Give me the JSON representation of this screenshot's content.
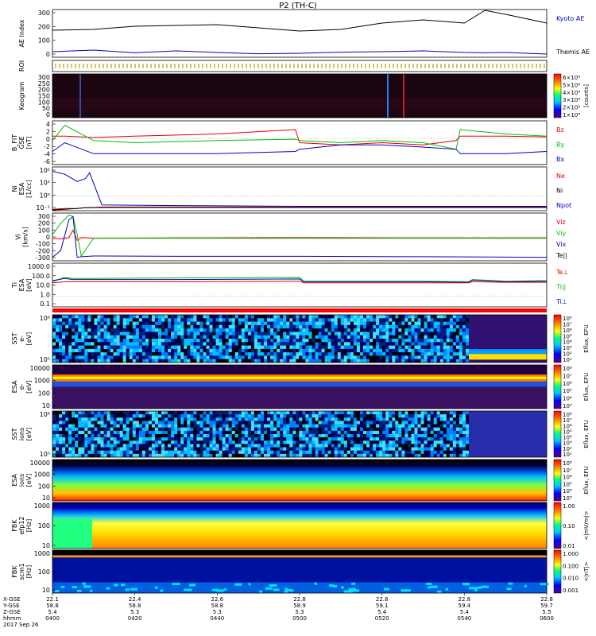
{
  "title": "P2 (TH-C)",
  "date_label": "2017 Sep 26",
  "colors": {
    "black": "#000000",
    "red": "#e00000",
    "green": "#00c000",
    "blue": "#0000c0",
    "navy": "#000080"
  },
  "x_axis": {
    "row_labels": [
      "X-GSE",
      "Y-GSE",
      "Z-GSE",
      "hhmm"
    ],
    "ticks": [
      {
        "time": "0400",
        "x_gse": "22.1",
        "y_gse": "58.8",
        "z_gse": "5.4"
      },
      {
        "time": "0420",
        "x_gse": "22.4",
        "y_gse": "58.8",
        "z_gse": "5.3"
      },
      {
        "time": "0440",
        "x_gse": "22.6",
        "y_gse": "58.8",
        "z_gse": "5.3"
      },
      {
        "time": "0500",
        "x_gse": "22.8",
        "y_gse": "58.9",
        "z_gse": "5.3"
      },
      {
        "time": "0520",
        "x_gse": "22.8",
        "y_gse": "59.1",
        "z_gse": "5.4"
      },
      {
        "time": "0540",
        "x_gse": "22.8",
        "y_gse": "59.4",
        "z_gse": "5.4"
      },
      {
        "time": "0600",
        "x_gse": "22.8",
        "y_gse": "59.7",
        "z_gse": "5.5"
      }
    ]
  },
  "panels": [
    {
      "key": "ae",
      "ylabel": [
        "AE Index"
      ],
      "ticks": [
        "300",
        "200",
        "100",
        "0"
      ],
      "legend": [
        {
          "text": "Kyoto AE",
          "color": "#0000c0"
        },
        {
          "text": "Themis AE",
          "color": "#000000"
        }
      ]
    },
    {
      "key": "roi",
      "ylabel": [
        "ROI"
      ],
      "ticks": [],
      "legend": []
    },
    {
      "key": "keogram",
      "ylabel": [
        "Keogram"
      ],
      "ticks": [
        "300",
        "250",
        "200",
        "150",
        "100",
        "50",
        "0"
      ],
      "legend": [],
      "colorbar": {
        "labels": [
          "6×10⁴",
          "5×10⁴",
          "4×10⁴",
          "3×10⁴",
          "2×10⁴",
          "1×10⁴"
        ],
        "title": "[counts]"
      }
    },
    {
      "key": "bfit",
      "ylabel": [
        "B_FIT",
        "GSE",
        "[nT]"
      ],
      "ticks": [
        "4",
        "2",
        "0",
        "-2",
        "-4",
        "-6"
      ],
      "legend": [
        {
          "text": "Bz",
          "color": "#e00000"
        },
        {
          "text": "By",
          "color": "#00c000"
        },
        {
          "text": "Bx",
          "color": "#0000c0"
        }
      ]
    },
    {
      "key": "ni",
      "ylabel": [
        "Ni",
        "ESA",
        "[1/cc]"
      ],
      "ticks": [
        "10²",
        "10¹",
        "10⁰",
        "10⁻¹"
      ],
      "legend": [
        {
          "text": "Ne",
          "color": "#e00000"
        },
        {
          "text": "Ni",
          "color": "#000000"
        },
        {
          "text": "Npot",
          "color": "#0000c0"
        }
      ]
    },
    {
      "key": "vi",
      "ylabel": [
        "Vi",
        "[km/s]"
      ],
      "ticks": [
        "300",
        "200",
        "100",
        "0",
        "-100",
        "-200",
        "-300"
      ],
      "legend": [
        {
          "text": "Viz",
          "color": "#e00000"
        },
        {
          "text": "Viy",
          "color": "#00c000"
        },
        {
          "text": "Vix",
          "color": "#0000c0"
        },
        {
          "text": "Te||",
          "color": "#000000"
        }
      ]
    },
    {
      "key": "ti",
      "ylabel": [
        "Ti",
        "ESA",
        "[eV]"
      ],
      "ticks": [
        "1000.0",
        "100.0",
        "10.0",
        "1.0",
        "0.1"
      ],
      "legend": [
        {
          "text": "Te⊥",
          "color": "#e00000"
        },
        {
          "text": "Ti||",
          "color": "#00c000"
        },
        {
          "text": "Ti⊥",
          "color": "#0000c0"
        }
      ]
    },
    {
      "key": "mode",
      "ylabel": [],
      "ticks": [],
      "legend": []
    },
    {
      "key": "sst_e",
      "ylabel": [
        "SST",
        "e-",
        "[eV]"
      ],
      "ticks": [
        "10⁶",
        "10⁵"
      ],
      "legend": [],
      "colorbar": {
        "labels": [
          "10⁸",
          "10⁷",
          "10⁶",
          "10⁵",
          "10⁴",
          "10³",
          "10²",
          "10¹"
        ],
        "title": "Eflux, EFU"
      }
    },
    {
      "key": "esa_e",
      "ylabel": [
        "ESA",
        "e-",
        "[eV]"
      ],
      "ticks": [
        "10000",
        "1000",
        "100",
        "10"
      ],
      "legend": [],
      "colorbar": {
        "labels": [
          "10⁸",
          "10⁷",
          "10⁶",
          "10⁵",
          "10⁴",
          "10³"
        ],
        "title": "Eflux, EFU"
      }
    },
    {
      "key": "sst_i",
      "ylabel": [
        "SST",
        "ions",
        "[eV]"
      ],
      "ticks": [
        "10⁶",
        "10⁵"
      ],
      "legend": [],
      "colorbar": {
        "labels": [
          "10⁸",
          "10⁷",
          "10⁶",
          "10⁵",
          "10⁴",
          "10³",
          "10²",
          "10¹"
        ],
        "title": "Eflux, EFU"
      }
    },
    {
      "key": "esa_i",
      "ylabel": [
        "ESA",
        "ions",
        "[eV]"
      ],
      "ticks": [
        "10000",
        "1000",
        "100",
        "10"
      ],
      "legend": [],
      "colorbar": {
        "labels": [
          "10⁸",
          "10⁷",
          "10⁶",
          "10⁵",
          "10⁴",
          "10³"
        ],
        "title": "Eflux, EFU"
      }
    },
    {
      "key": "fbk_e",
      "ylabel": [
        "FBK",
        "efp12",
        "[Hz]"
      ],
      "ticks": [
        "1000",
        "100",
        "10"
      ],
      "legend": [],
      "colorbar": {
        "labels": [
          "1.00",
          "0.10",
          "0.01"
        ],
        "title": "<|mV/m|>"
      }
    },
    {
      "key": "fbk_b",
      "ylabel": [
        "FBK",
        "scm1",
        "[Hz]"
      ],
      "ticks": [
        "1000",
        "100",
        "10"
      ],
      "legend": [],
      "colorbar": {
        "labels": [
          "1.000",
          "0.100",
          "0.010",
          "0.001"
        ],
        "title": "<|nT|>"
      }
    }
  ],
  "chart_data": {
    "type": "line",
    "title": "P2 (TH-C)",
    "x_tick_labels": [
      "0400",
      "0420",
      "0440",
      "0500",
      "0520",
      "0540",
      "0600"
    ],
    "x_range": [
      "0400",
      "0600"
    ],
    "line_panels": [
      {
        "panel": "AE Index",
        "ylim": [
          0,
          300
        ],
        "x": [
          "0400",
          "0410",
          "0420",
          "0430",
          "0440",
          "0450",
          "0500",
          "0510",
          "0520",
          "0530",
          "0540",
          "0545",
          "0550",
          "0600"
        ],
        "series": [
          {
            "name": "Themis AE",
            "color": "#000000",
            "values": [
              170,
              175,
              195,
              200,
              205,
              185,
              165,
              175,
              215,
              235,
              215,
              295,
              270,
              215
            ]
          },
          {
            "name": "Kyoto AE",
            "color": "#0000c0",
            "values": [
              35,
              45,
              28,
              40,
              30,
              22,
              25,
              32,
              35,
              40,
              30,
              28,
              30,
              20
            ]
          }
        ]
      },
      {
        "panel": "B_FIT GSE [nT]",
        "ylim": [
          -6,
          4
        ],
        "x": [
          "0400",
          "0403",
          "0410",
          "0420",
          "0440",
          "0459",
          "0500",
          "0510",
          "0520",
          "0530",
          "0538",
          "0539",
          "0550",
          "0600"
        ],
        "series": [
          {
            "name": "Bz",
            "color": "#e00000",
            "values": [
              0.5,
              0.5,
              0.2,
              0.5,
              1.0,
              2.0,
              -1.0,
              -1.5,
              -1.0,
              -1.5,
              -0.5,
              0.5,
              0.5,
              0.3
            ]
          },
          {
            "name": "By",
            "color": "#00c000",
            "values": [
              -0.5,
              3.0,
              -0.5,
              -1.0,
              -0.5,
              -0.2,
              -0.5,
              -1.0,
              -0.5,
              -1.0,
              -2.5,
              2.0,
              1.0,
              0.5
            ]
          },
          {
            "name": "Bx",
            "color": "#0000c0",
            "values": [
              -3.0,
              -1.0,
              -3.5,
              -3.5,
              -3.5,
              -3.0,
              -2.5,
              -1.5,
              -1.5,
              -2.0,
              -2.5,
              -3.5,
              -3.5,
              -3.0
            ]
          }
        ]
      },
      {
        "panel": "Ni ESA [1/cc]",
        "ylim": [
          -1,
          2
        ],
        "y_scale": "log10 exponent",
        "x": [
          "0400",
          "0403",
          "0406",
          "0408",
          "0409",
          "0412",
          "0430",
          "0500",
          "0530",
          "0600"
        ],
        "series": [
          {
            "name": "Npot",
            "color": "#0000c0",
            "values": [
              1.7,
              1.5,
              1.0,
              1.2,
              1.6,
              -0.6,
              -0.65,
              -0.7,
              -0.7,
              -0.7
            ]
          },
          {
            "name": "Ne",
            "color": "#e00000",
            "values": [
              -0.9,
              -0.85,
              -0.85,
              -0.8,
              -0.8,
              -0.75,
              -0.75,
              -0.75,
              -0.75,
              -0.75
            ]
          },
          {
            "name": "Ni",
            "color": "#000000",
            "values": [
              -0.95,
              -0.9,
              -0.85,
              -0.8,
              -0.8,
              -0.78,
              -0.78,
              -0.78,
              -0.78,
              -0.78
            ]
          }
        ]
      },
      {
        "panel": "Vi [km/s]",
        "ylim": [
          -350,
          350
        ],
        "x": [
          "0400",
          "0402",
          "0404",
          "0405",
          "0406",
          "0407",
          "0410",
          "0430",
          "0500",
          "0530",
          "0600"
        ],
        "series": [
          {
            "name": "Viz",
            "color": "#e00000",
            "values": [
              -20,
              -30,
              -10,
              100,
              -50,
              -10,
              -20,
              -15,
              -10,
              -15,
              -15
            ]
          },
          {
            "name": "Viy",
            "color": "#00c000",
            "values": [
              30,
              200,
              320,
              300,
              40,
              -280,
              -20,
              -20,
              -20,
              -20,
              -20
            ]
          },
          {
            "name": "Vix",
            "color": "#0000c0",
            "values": [
              -300,
              -200,
              250,
              300,
              -300,
              -290,
              -280,
              -285,
              -285,
              -290,
              -300
            ]
          }
        ]
      },
      {
        "panel": "Ti ESA [eV]",
        "ylim": [
          -1,
          3
        ],
        "y_scale": "log10 exponent",
        "x": [
          "0400",
          "0403",
          "0405",
          "0430",
          "0500",
          "0501",
          "0530",
          "0541",
          "0542",
          "0550",
          "0600"
        ],
        "series": [
          {
            "name": "Ti||",
            "color": "#00c000",
            "values": [
              1.3,
              1.7,
              1.6,
              1.65,
              1.7,
              1.35,
              1.35,
              1.3,
              1.5,
              1.35,
              1.4
            ]
          },
          {
            "name": "Ti⊥",
            "color": "#0000c0",
            "values": [
              1.4,
              1.6,
              1.5,
              1.5,
              1.55,
              1.3,
              1.3,
              1.25,
              1.45,
              1.3,
              1.35
            ]
          },
          {
            "name": "Te⊥",
            "color": "#e00000",
            "values": [
              1.2,
              1.3,
              1.3,
              1.3,
              1.35,
              1.2,
              1.2,
              1.2,
              1.3,
              1.25,
              1.25
            ]
          }
        ]
      }
    ]
  }
}
